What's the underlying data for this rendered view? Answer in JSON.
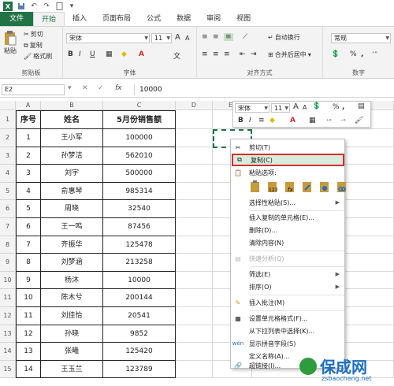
{
  "tabs": [
    "文件",
    "开始",
    "插入",
    "页面布局",
    "公式",
    "数据",
    "审阅",
    "视图"
  ],
  "ribbon": {
    "clipboard": {
      "paste": "粘贴",
      "cut": "剪切",
      "copy": "复制",
      "format_painter": "格式刷",
      "label": "剪贴板"
    },
    "font": {
      "name": "宋体",
      "size": "11",
      "label": "字体",
      "bold": "B",
      "italic": "I",
      "underline": "U",
      "grow": "A",
      "shrink": "A"
    },
    "alignment": {
      "wrap": "自动换行",
      "merge": "合并后居中",
      "label": "对齐方式"
    },
    "number": {
      "format": "常规",
      "percent": "%",
      "comma": ",",
      "label": "数字"
    }
  },
  "formula_bar": {
    "name_box": "E2",
    "cancel": "✕",
    "enter": "✓",
    "fx": "fx",
    "value": "10000"
  },
  "columns": [
    "A",
    "B",
    "C",
    "D",
    "E"
  ],
  "headers": [
    "序号",
    "姓名",
    "5月份销售额"
  ],
  "rows": [
    [
      "1",
      "王小军",
      "100000"
    ],
    [
      "2",
      "孙梦洁",
      "562010"
    ],
    [
      "3",
      "刘宇",
      "500000"
    ],
    [
      "4",
      "俞惠琴",
      "985314"
    ],
    [
      "5",
      "周晓",
      "32540"
    ],
    [
      "6",
      "王一鸣",
      "87456"
    ],
    [
      "7",
      "齐振华",
      "125478"
    ],
    [
      "8",
      "刘梦涵",
      "213258"
    ],
    [
      "9",
      "杨沐",
      "10000"
    ],
    [
      "10",
      "陈木兮",
      "200144"
    ],
    [
      "11",
      "刘佳怡",
      "20541"
    ],
    [
      "12",
      "孙晓",
      "9852"
    ],
    [
      "13",
      "张曦",
      "125420"
    ],
    [
      "14",
      "王玉兰",
      "123789"
    ]
  ],
  "row_numbers": [
    "1",
    "2",
    "3",
    "4",
    "5",
    "6",
    "7",
    "8",
    "9",
    "10",
    "11",
    "12",
    "13",
    "14",
    "15"
  ],
  "mini_toolbar": {
    "font": "宋体",
    "size": "11",
    "percent": "%",
    "comma": ","
  },
  "context_menu": {
    "cut": "剪切(T)",
    "copy": "复制(C)",
    "paste_options": "粘贴选项:",
    "paste_special": "选择性粘贴(S)...",
    "insert_copied": "插入复制的单元格(E)...",
    "delete": "删除(D)...",
    "clear": "清除内容(N)",
    "quick_analysis": "快速分析(Q)",
    "filter": "筛选(E)",
    "sort": "排序(O)",
    "insert_comment": "插入批注(M)",
    "format_cells": "设置单元格格式(F)...",
    "pick_list": "从下拉列表中选择(K)...",
    "phonetic": "显示拼音字段(S)",
    "define_name": "定义名称(A)...",
    "hyperlink": "超链接(I)..."
  },
  "watermark": {
    "text": "保成网",
    "url": "zsbaocheng.net"
  },
  "colors": {
    "excel_green": "#217346",
    "highlight_red": "#d32f2f",
    "menu_highlight": "#d7ecdc"
  }
}
